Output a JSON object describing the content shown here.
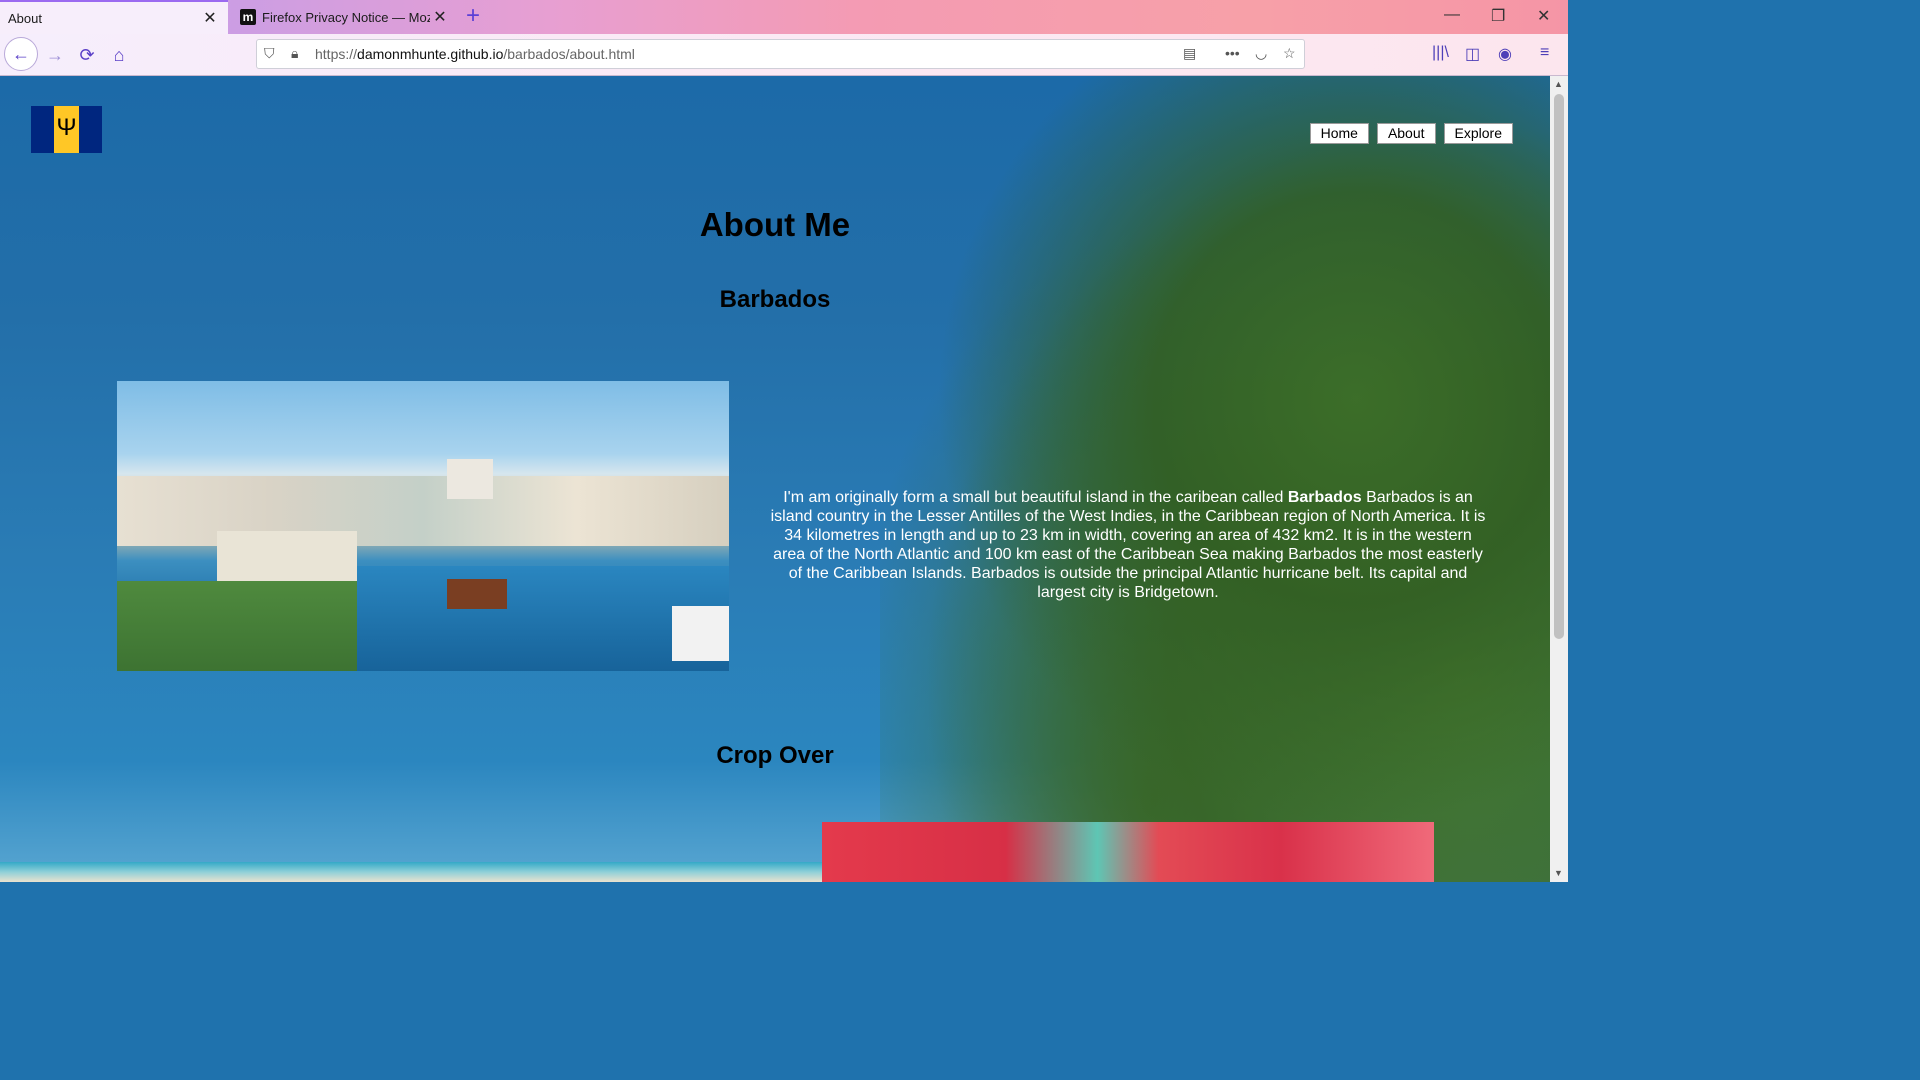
{
  "browser": {
    "tabs": [
      {
        "title": "About",
        "active": true
      },
      {
        "title": "Firefox Privacy Notice — Mozil",
        "active": false,
        "favicon": "m"
      }
    ],
    "new_tab_label": "+",
    "url_prefix": "https://",
    "url_domain": "damonmhunte.github.io",
    "url_path": "/barbados/about.html",
    "icons": {
      "back": "←",
      "forward": "→",
      "reload": "⟳",
      "home": "⌂",
      "reader": "▤",
      "more": "•••",
      "pocket": "◡",
      "star": "☆",
      "library": "|||\\",
      "sidebar": "◫",
      "account": "◉",
      "menu": "≡",
      "minimize": "—",
      "restore": "❐",
      "close": "✕"
    }
  },
  "site": {
    "nav": {
      "home": "Home",
      "about": "About",
      "explore": "Explore"
    },
    "page_title": "About Me",
    "section1_heading": "Barbados",
    "para_intro": "I'm am originally form a small but beautiful island in the caribean called ",
    "para_bold": "Barbados",
    "para_rest": " Barbados is an island country in the Lesser Antilles of the West Indies, in the Caribbean region of North America. It is 34 kilometres in length and up to 23 km in width, covering an area of 432 km2. It is in the western area of the North Atlantic and 100 km east of the Caribbean Sea making Barbados the most easterly of the Caribbean Islands. Barbados is outside the principal Atlantic hurricane belt. Its capital and largest city is Bridgetown.",
    "section2_heading": "Crop Over"
  },
  "colors": {
    "flag_blue": "#00267f",
    "flag_gold": "#ffc726",
    "accent_purple": "#9b6af0"
  }
}
